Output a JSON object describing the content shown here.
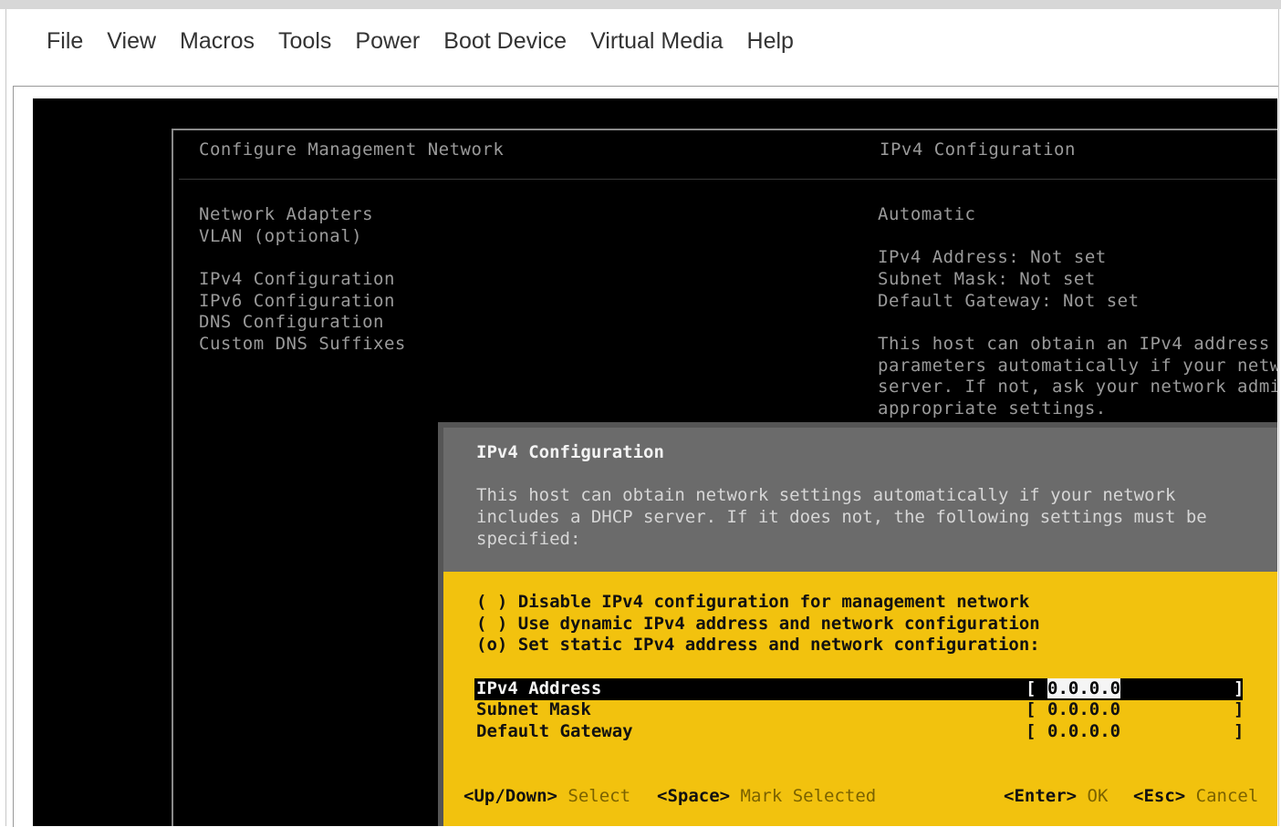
{
  "menubar": {
    "items": [
      "File",
      "View",
      "Macros",
      "Tools",
      "Power",
      "Boot Device",
      "Virtual Media",
      "Help"
    ]
  },
  "left_panel": {
    "title": "Configure Management Network",
    "items": [
      "Network Adapters",
      "VLAN (optional)",
      "IPv4 Configuration",
      "IPv6 Configuration",
      "DNS Configuration",
      "Custom DNS Suffixes"
    ]
  },
  "right_panel": {
    "title": "IPv4 Configuration",
    "mode": "Automatic",
    "details": [
      "IPv4 Address: Not set",
      "Subnet Mask: Not set",
      "Default Gateway: Not set"
    ],
    "help": [
      "This host can obtain an IPv4 address",
      "parameters automatically if your netw",
      "server. If not, ask your network admi",
      "appropriate settings."
    ]
  },
  "dialog": {
    "title": "IPv4 Configuration",
    "description": [
      "This host can obtain network settings automatically if your network",
      "includes a DHCP server. If it does not, the following settings must be",
      "specified:"
    ],
    "options": [
      "( ) Disable IPv4 configuration for management network",
      "( ) Use dynamic IPv4 address and network configuration",
      "(o) Set static IPv4 address and network configuration:"
    ],
    "fields": [
      {
        "label": "IPv4 Address",
        "value": "0.0.0.0"
      },
      {
        "label": "Subnet Mask",
        "value": "0.0.0.0"
      },
      {
        "label": "Default Gateway",
        "value": "0.0.0.0"
      }
    ],
    "footer": {
      "updown_key": "<Up/Down>",
      "updown_action": "Select",
      "space_key": "<Space>",
      "space_action": "Mark Selected",
      "enter_key": "<Enter>",
      "enter_action": "OK",
      "esc_key": "<Esc>",
      "esc_action": "Cancel"
    }
  },
  "colors": {
    "console_bg": "#000000",
    "dialog_body": "#f2c20e",
    "dialog_head": "#6b6b6b",
    "console_text": "#9a9a9a"
  }
}
